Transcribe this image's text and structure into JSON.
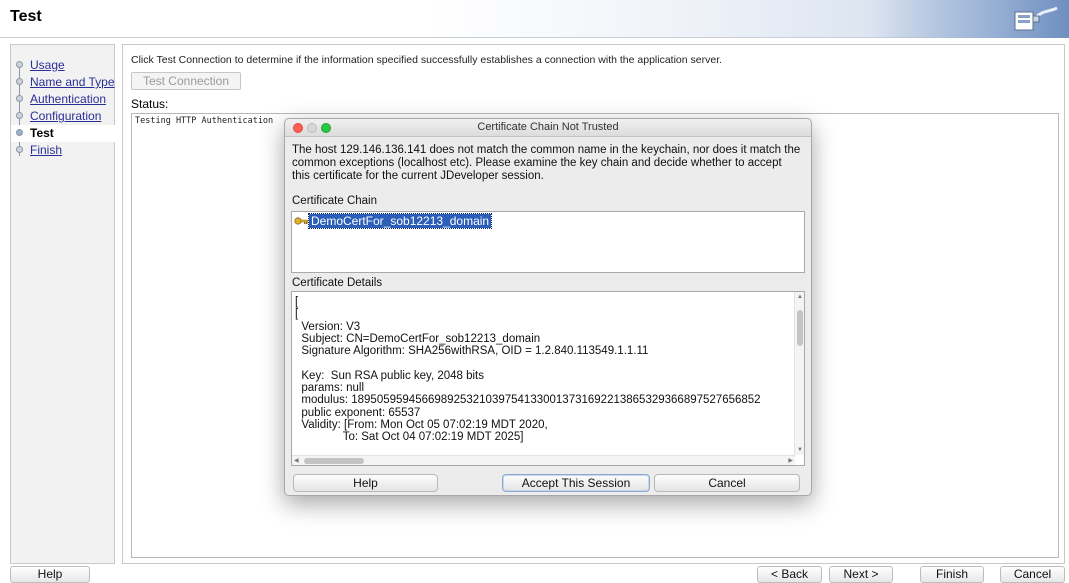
{
  "header": {
    "title": "Test"
  },
  "nav": {
    "items": [
      {
        "label": "Usage",
        "active": false
      },
      {
        "label": "Name and Type",
        "active": false
      },
      {
        "label": "Authentication",
        "active": false
      },
      {
        "label": "Configuration",
        "active": false
      },
      {
        "label": "Test",
        "active": true
      },
      {
        "label": "Finish",
        "active": false
      }
    ]
  },
  "main": {
    "instruction": "Click Test Connection to determine if the information specified successfully establishes a connection with the application server.",
    "test_connection_label": "Test Connection",
    "status_label": "Status:",
    "status_text": "Testing HTTP Authentication"
  },
  "footer": {
    "help_label": "Help",
    "back_label": "< Back",
    "next_label": "Next >",
    "finish_label": "Finish",
    "cancel_label": "Cancel"
  },
  "dialog": {
    "title": "Certificate Chain Not Trusted",
    "message": "The host 129.146.136.141 does not match the common name in the keychain, nor does it match the common exceptions (localhost etc). Please examine the key chain and decide whether to accept this certificate for the current JDeveloper session.",
    "chain_label": "Certificate Chain",
    "chain_items": [
      "DemoCertFor_sob12213_domain"
    ],
    "details_label": "Certificate Details",
    "details_text": "[\n[\n  Version: V3\n  Subject: CN=DemoCertFor_sob12213_domain\n  Signature Algorithm: SHA256withRSA, OID = 1.2.840.113549.1.1.11\n\n  Key:  Sun RSA public key, 2048 bits\n  params: null\n  modulus: 1895059594566989253210397541330013731692213865329366897527656852\n  public exponent: 65537\n  Validity: [From: Mon Oct 05 07:02:19 MDT 2020,\n               To: Sat Oct 04 07:02:19 MDT 2025]",
    "help_label": "Help",
    "accept_label": "Accept This Session",
    "cancel_label": "Cancel"
  },
  "colors": {
    "link": "#2a2f96",
    "selection": "#2b5fb9",
    "close_button": "#fe5f57",
    "zoom_button": "#28c840"
  }
}
